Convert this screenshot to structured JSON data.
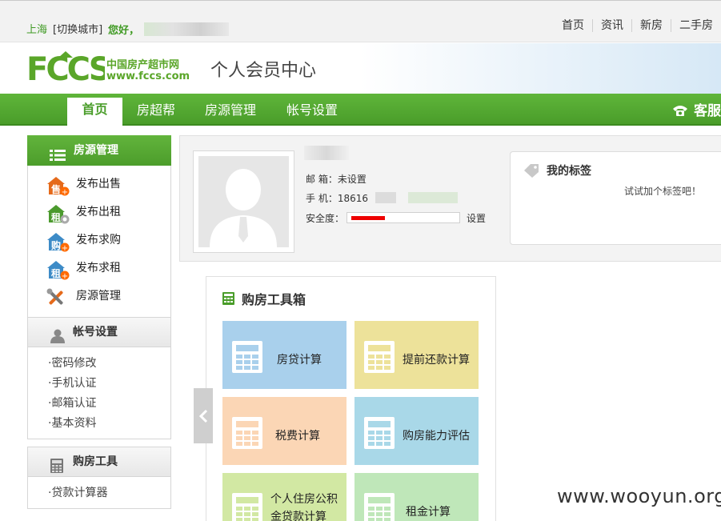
{
  "topbar": {
    "city": "上海",
    "switch_city": "[切换城市]",
    "greeting": "您好，",
    "links": [
      "首页",
      "资讯",
      "新房",
      "二手房"
    ]
  },
  "header": {
    "logo_text": "FCCS",
    "logo_cn": "中国房产超市网",
    "logo_url": "www.fccs.com",
    "title": "个人会员中心"
  },
  "nav": {
    "items": [
      "首页",
      "房超帮",
      "房源管理",
      "帐号设置"
    ],
    "active": "首页",
    "service": "客服"
  },
  "sidebar": {
    "house_head": "房源管理",
    "house_items": [
      {
        "label": "发布出售",
        "icon": "sell-icon",
        "badge": "售"
      },
      {
        "label": "发布出租",
        "icon": "rent-icon",
        "badge": "租"
      },
      {
        "label": "发布求购",
        "icon": "want-buy-icon",
        "badge": "购"
      },
      {
        "label": "发布求租",
        "icon": "want-rent-icon",
        "badge": "租"
      },
      {
        "label": "房源管理",
        "icon": "tools-icon",
        "badge": ""
      }
    ],
    "account_head": "帐号设置",
    "account_items": [
      "·密码修改",
      "·手机认证",
      "·邮箱认证",
      "·基本资料"
    ],
    "tools_head": "购房工具",
    "tools_items": [
      "·贷款计算器"
    ]
  },
  "profile": {
    "email_label": "邮 箱：",
    "email_value": "未设置",
    "phone_label": "手 机：",
    "phone_value": "18616",
    "security_label": "安全度：",
    "security_level": 0.3,
    "security_action": "设置",
    "tags_title": "我的标签",
    "tags_hint": "试试加个标签吧！"
  },
  "toolbox": {
    "title": "购房工具箱",
    "tools": [
      {
        "label": "房贷计算",
        "color": "#a9d0ec"
      },
      {
        "label": "提前还款计算",
        "color": "#ede29a"
      },
      {
        "label": "税费计算",
        "color": "#fbd6b5"
      },
      {
        "label": "购房能力评估",
        "color": "#a9d8e8"
      },
      {
        "label": "个人住房公积金贷款计算",
        "color": "#d2e8a3"
      },
      {
        "label": "租金计算",
        "color": "#bfe7b9"
      }
    ]
  },
  "watermark": "www.wooyun.org",
  "colors": {
    "brand_green": "#4a9d2a",
    "accent_orange": "#ff6a00",
    "security_red": "#e00000"
  }
}
